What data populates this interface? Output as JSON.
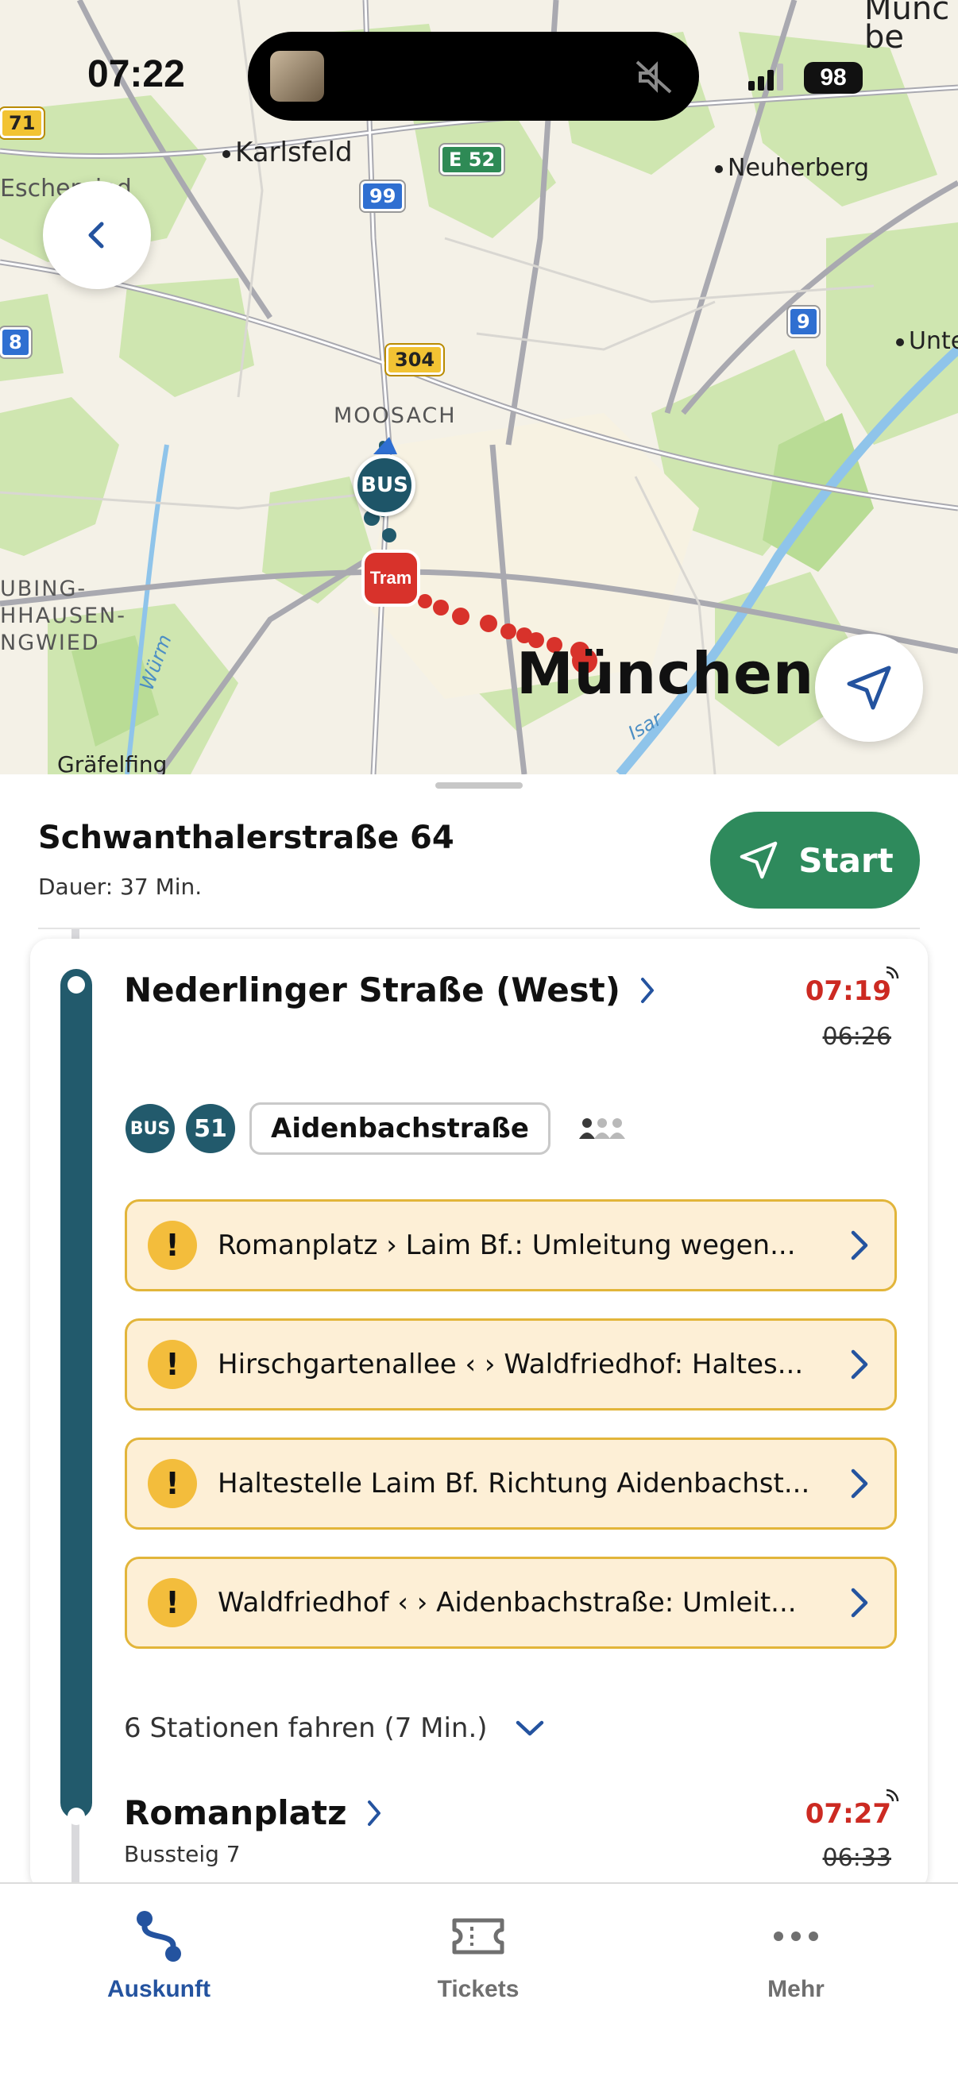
{
  "status_bar": {
    "time": "07:22",
    "battery": "98"
  },
  "map": {
    "places": {
      "muenchen": "München",
      "karlsfeld": "Karlsfeld",
      "neuherberg": "Neuherberg",
      "moosach": "MOOSACH",
      "eschenried": "Eschenried",
      "aubing": "UBING-",
      "lochhausen": "HHAUSEN-",
      "langwied": "NGWIED",
      "graefelfing": "Gräfelfing",
      "unter": "Unte",
      "top_right_1": "be",
      "top_right_2": "Münc",
      "wuerm": "Würm",
      "isar": "Isar"
    },
    "shields": {
      "a99": "99",
      "e52": "E 52",
      "b304": "304",
      "a9": "9",
      "left_1": "71",
      "left_2": "8"
    },
    "markers": {
      "bus": "BUS",
      "tram": "Tram"
    },
    "icons": {
      "back": "chevron-left-icon",
      "locate": "location-arrow-icon"
    }
  },
  "summary": {
    "destination": "Schwanthalerstraße 64",
    "duration": "Dauer: 37 Min.",
    "start_label": "Start"
  },
  "leg": {
    "from_stop": "Nederlinger Straße (West)",
    "from_time_realtime": "07:19",
    "from_time_scheduled": "06:26",
    "mode_badge": "BUS",
    "line": "51",
    "direction": "Aidenbachstraße",
    "alerts": [
      "Romanplatz › Laim Bf.: Umleitung wegen...",
      "Hirschgartenallee ‹ › Waldfriedhof: Haltes...",
      "Haltestelle Laim Bf. Richtung Aidenbachst...",
      "Waldfriedhof ‹ › Aidenbachstraße: Umleit..."
    ],
    "stations_info": "6 Stationen fahren (7 Min.)",
    "to_stop": "Romanplatz",
    "to_platform": "Bussteig 7",
    "to_time_realtime": "07:27",
    "to_time_scheduled": "06:33"
  },
  "colors": {
    "accent_green": "#2e8a5c",
    "line_teal": "#225a6c",
    "delay_red": "#cc2a22",
    "alert_bg": "#fdefd6",
    "alert_icon": "#f3bd3c",
    "tab_active": "#24539f"
  },
  "tabs": [
    {
      "label": "Auskunft",
      "icon": "route-icon",
      "active": true
    },
    {
      "label": "Tickets",
      "icon": "ticket-icon",
      "active": false
    },
    {
      "label": "Mehr",
      "icon": "more-dots-icon",
      "active": false
    }
  ]
}
